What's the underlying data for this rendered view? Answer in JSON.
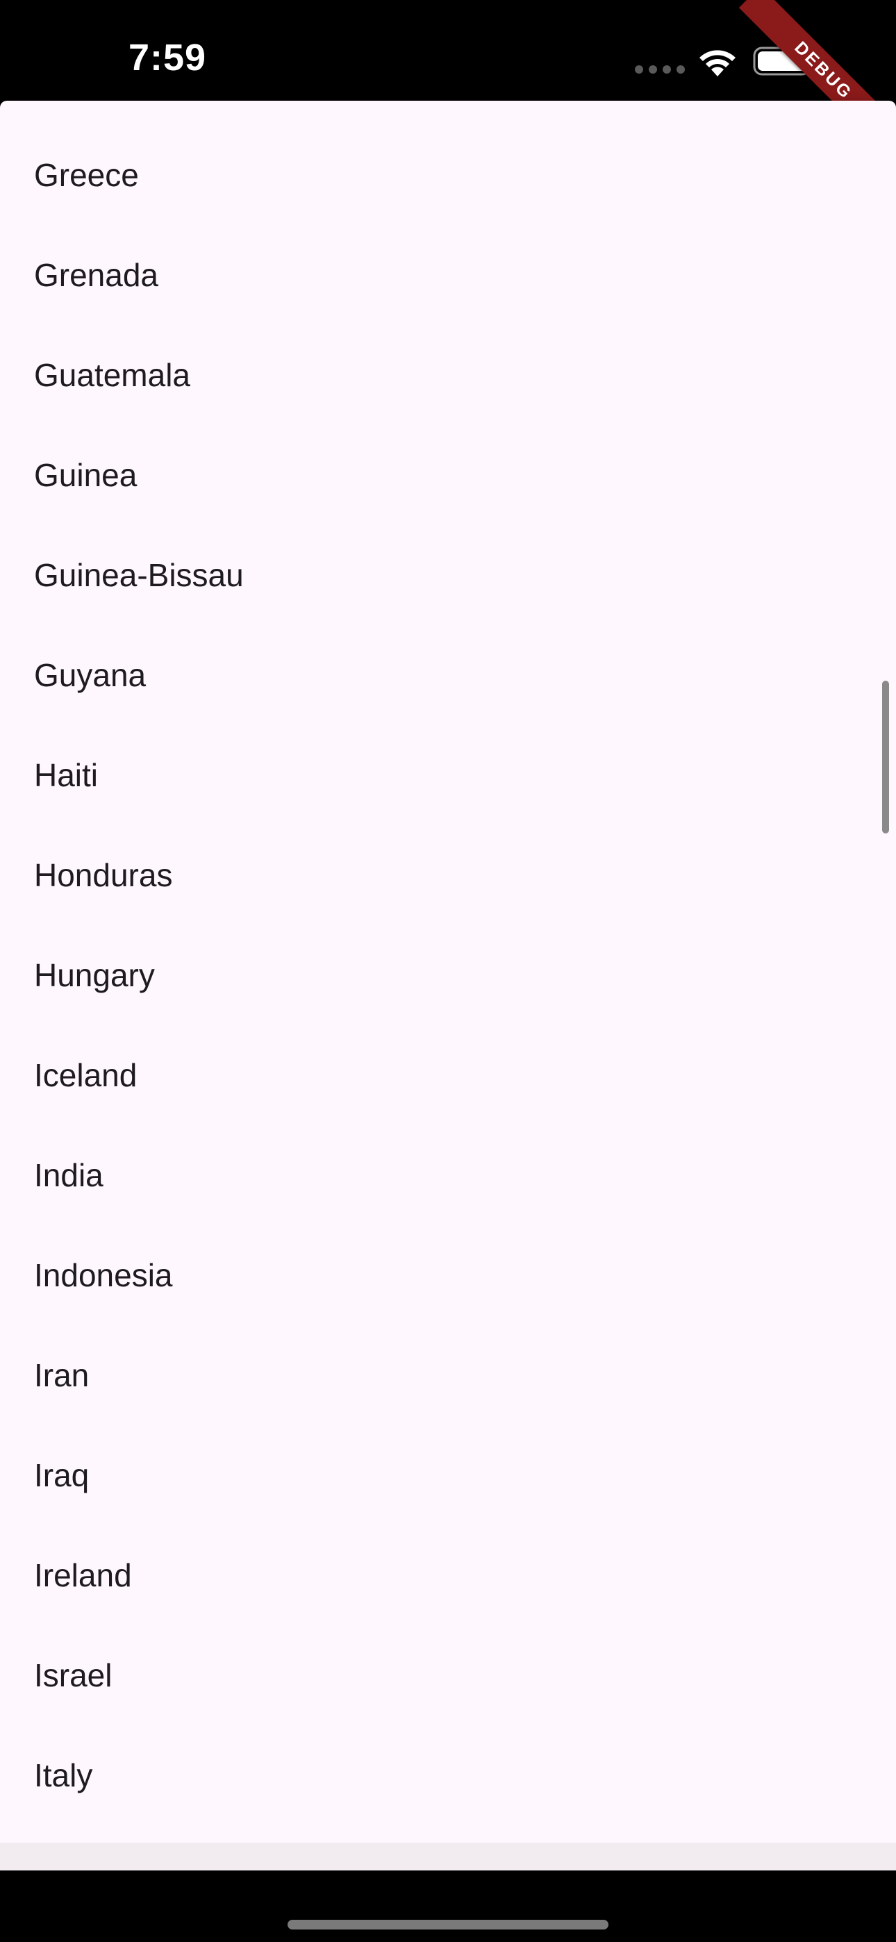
{
  "status_bar": {
    "time": "7:59",
    "icons": [
      "cellular-dots-icon",
      "wifi-icon",
      "battery-icon"
    ]
  },
  "debug_banner": {
    "label": "DEBUG",
    "color": "#8b1a1a"
  },
  "countries": [
    "Greece",
    "Grenada",
    "Guatemala",
    "Guinea",
    "Guinea-Bissau",
    "Guyana",
    "Haiti",
    "Honduras",
    "Hungary",
    "Iceland",
    "India",
    "Indonesia",
    "Iran",
    "Iraq",
    "Ireland",
    "Israel",
    "Italy"
  ],
  "colors": {
    "sheet_background": "#fef7fd",
    "text": "#1d1b20"
  }
}
